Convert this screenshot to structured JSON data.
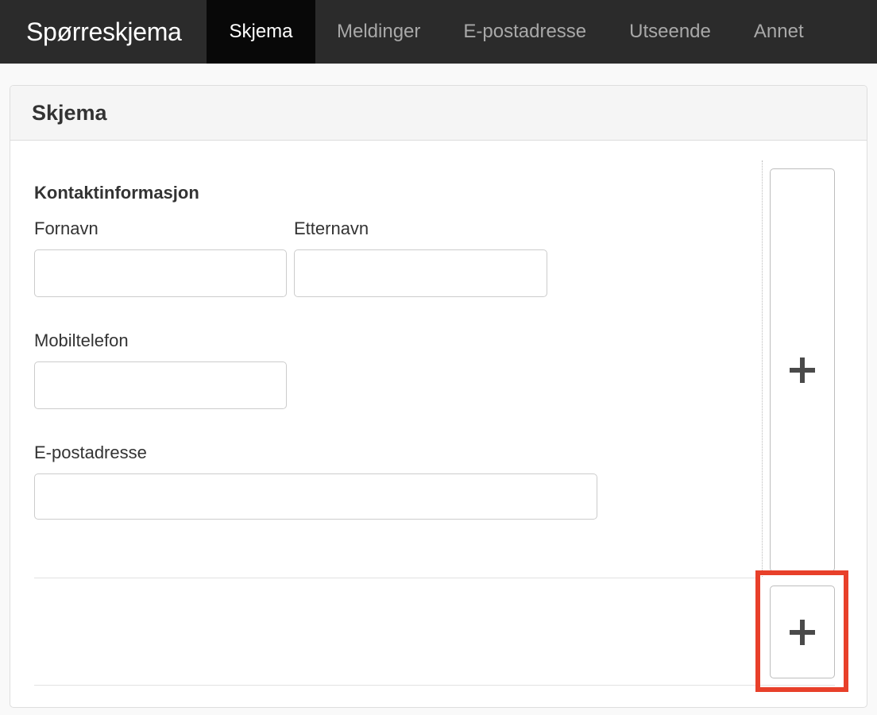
{
  "navbar": {
    "brand": "Spørreskjema",
    "tabs": [
      {
        "label": "Skjema",
        "active": true
      },
      {
        "label": "Meldinger",
        "active": false
      },
      {
        "label": "E-postadresse",
        "active": false
      },
      {
        "label": "Utseende",
        "active": false
      },
      {
        "label": "Annet",
        "active": false
      }
    ]
  },
  "panel": {
    "title": "Skjema",
    "section_title": "Kontaktinformasjon",
    "fields": {
      "first_name": {
        "label": "Fornavn",
        "value": ""
      },
      "last_name": {
        "label": "Etternavn",
        "value": ""
      },
      "mobile": {
        "label": "Mobiltelefon",
        "value": ""
      },
      "email": {
        "label": "E-postadresse",
        "value": ""
      }
    },
    "add_column_icon": "plus-icon",
    "add_row_icon": "plus-icon"
  },
  "colors": {
    "navbar_bg": "#2b2b2b",
    "active_tab_bg": "#080808",
    "highlight": "#e8402a"
  }
}
